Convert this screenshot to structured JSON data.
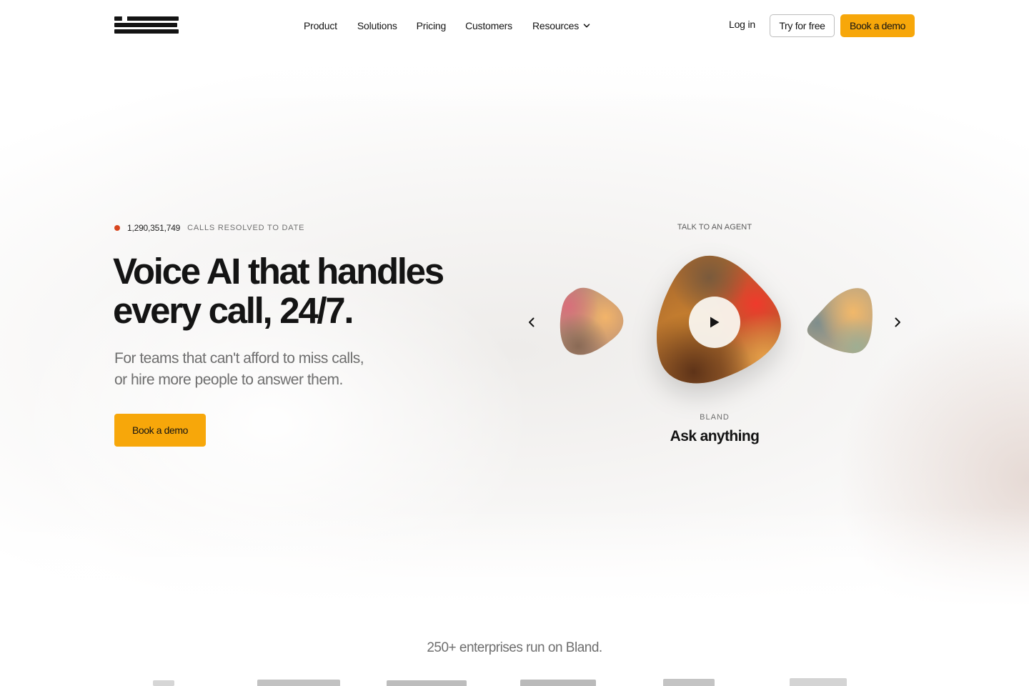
{
  "header": {
    "logo_alt": "bland",
    "nav": [
      {
        "label": "Product"
      },
      {
        "label": "Solutions"
      },
      {
        "label": "Pricing"
      },
      {
        "label": "Customers"
      },
      {
        "label": "Resources",
        "has_dropdown": true
      }
    ],
    "login_label": "Log in",
    "try_label": "Try for free",
    "demo_label": "Book a demo"
  },
  "hero": {
    "stat_value": "1,290,351,749",
    "stat_label": "CALLS RESOLVED TO DATE",
    "headline_line1": "Voice AI that handles",
    "headline_line2": "every call, 24/7.",
    "subhead_line1": "For teams that can't afford to miss calls,",
    "subhead_line2": "or hire more people to answer them.",
    "cta_label": "Book a demo"
  },
  "agent": {
    "title": "TALK TO AN AGENT",
    "brand": "BLAND",
    "name": "Ask anything",
    "prev_icon": "chevron-left-icon",
    "next_icon": "chevron-right-icon",
    "play_icon": "play-icon"
  },
  "social_proof": {
    "headline": "250+ enterprises run on Bland."
  },
  "colors": {
    "accent": "#f7a70a",
    "stat_dot": "#d8461f",
    "text": "#141414",
    "muted": "#6e6e6e"
  }
}
